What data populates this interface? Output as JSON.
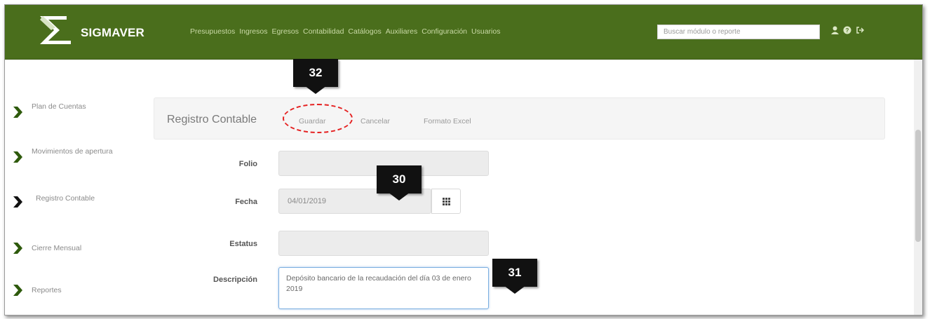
{
  "brand": {
    "name": "SIGMAVER"
  },
  "nav": {
    "menu": [
      "Presupuestos",
      "Ingresos",
      "Egresos",
      "Contabilidad",
      "Catálogos",
      "Auxiliares",
      "Configuración",
      "Usuarios"
    ],
    "search_placeholder": "Buscar módulo o reporte",
    "icons": [
      "user-icon",
      "help-icon",
      "logout-icon"
    ]
  },
  "sidebar": {
    "items": [
      {
        "label": "Plan de Cuentas"
      },
      {
        "label": "Movimientos de apertura"
      },
      {
        "label": "Registro Contable"
      },
      {
        "label": "Cierre Mensual"
      },
      {
        "label": "Reportes"
      }
    ]
  },
  "toolbar": {
    "title": "Registro Contable",
    "save_label": "Guardar",
    "cancel_label": "Cancelar",
    "excel_label": "Formato Excel"
  },
  "form": {
    "folio_label": "Folio",
    "folio_value": "",
    "fecha_label": "Fecha",
    "fecha_value": "04/01/2019",
    "estatus_label": "Estatus",
    "estatus_value": "",
    "descripcion_label": "Descripción",
    "descripcion_value": "Depósito bancario de la recaudación del día 03 de enero 2019"
  },
  "callouts": {
    "guardar": "32",
    "fecha": "30",
    "descripcion": "31"
  },
  "colors": {
    "navbar": "#4a6e1c",
    "accent_green": "#2e5a0c",
    "callout": "#111111",
    "highlight_ring": "#e52222"
  }
}
